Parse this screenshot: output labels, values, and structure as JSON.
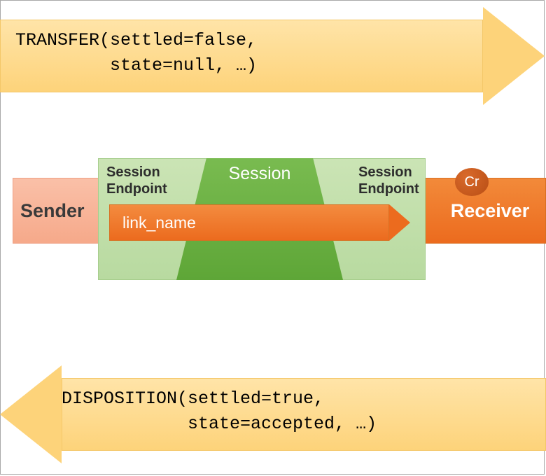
{
  "transfer": {
    "line1": "TRANSFER(settled=false,",
    "line2": "         state=null, …)"
  },
  "disposition": {
    "line1": "DISPOSITION(settled=true,",
    "line2": "            state=accepted, …)"
  },
  "sender_label": "Sender",
  "receiver_label": "Receiver",
  "session": {
    "title": "Session",
    "endpoint_left_l1": "Session",
    "endpoint_left_l2": "Endpoint",
    "endpoint_right_l1": "Session",
    "endpoint_right_l2": "Endpoint"
  },
  "link_name": "link_name",
  "credit_badge": "Cr"
}
